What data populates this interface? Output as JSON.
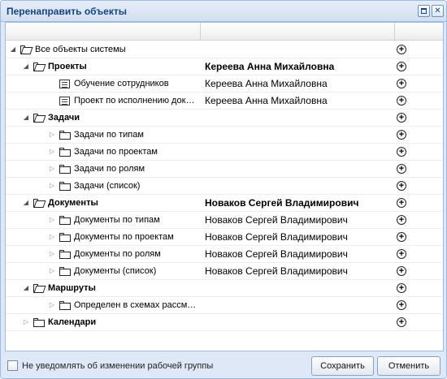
{
  "window": {
    "title": "Перенаправить объекты",
    "maximize_label": "",
    "close_label": "✕"
  },
  "tree": {
    "rows": [
      {
        "label": "Все объекты системы",
        "assignee": "",
        "bold": false,
        "icon": "folder-open-icon",
        "arrow": "expanded"
      },
      {
        "label": "Проекты",
        "assignee": "Кереева Анна Михайловна",
        "bold": true,
        "icon": "folder-open-icon",
        "arrow": "expanded"
      },
      {
        "label": "Обучение сотрудников",
        "assignee": "Кереева Анна Михайловна",
        "bold": false,
        "icon": "document-icon",
        "arrow": "none"
      },
      {
        "label": "Проект по исполнению докуме...",
        "assignee": "Кереева Анна Михайловна",
        "bold": false,
        "icon": "document-icon",
        "arrow": "none"
      },
      {
        "label": "Задачи",
        "assignee": "",
        "bold": true,
        "icon": "folder-open-icon",
        "arrow": "expanded"
      },
      {
        "label": "Задачи по типам",
        "assignee": "",
        "bold": false,
        "icon": "folder-icon",
        "arrow": "collapsed"
      },
      {
        "label": "Задачи по проектам",
        "assignee": "",
        "bold": false,
        "icon": "folder-icon",
        "arrow": "collapsed"
      },
      {
        "label": "Задачи по ролям",
        "assignee": "",
        "bold": false,
        "icon": "folder-icon",
        "arrow": "collapsed"
      },
      {
        "label": "Задачи (список)",
        "assignee": "",
        "bold": false,
        "icon": "folder-icon",
        "arrow": "collapsed"
      },
      {
        "label": "Документы",
        "assignee": "Новаков Сергей Владимирович",
        "bold": true,
        "icon": "folder-open-icon",
        "arrow": "expanded"
      },
      {
        "label": "Документы по типам",
        "assignee": "Новаков Сергей Владимирович",
        "bold": false,
        "icon": "folder-icon",
        "arrow": "collapsed"
      },
      {
        "label": "Документы по проектам",
        "assignee": "Новаков Сергей Владимирович",
        "bold": false,
        "icon": "folder-icon",
        "arrow": "collapsed"
      },
      {
        "label": "Документы по ролям",
        "assignee": "Новаков Сергей Владимирович",
        "bold": false,
        "icon": "folder-icon",
        "arrow": "collapsed"
      },
      {
        "label": "Документы (список)",
        "assignee": "Новаков Сергей Владимирович",
        "bold": false,
        "icon": "folder-icon",
        "arrow": "collapsed"
      },
      {
        "label": "Маршруты",
        "assignee": "",
        "bold": true,
        "icon": "folder-open-icon",
        "arrow": "expanded"
      },
      {
        "label": "Определен в схемах рассмотр...",
        "assignee": "",
        "bold": false,
        "icon": "folder-icon",
        "arrow": "collapsed"
      },
      {
        "label": "Календари",
        "assignee": "",
        "bold": true,
        "icon": "folder-icon",
        "arrow": "collapsed"
      }
    ]
  },
  "footer": {
    "notify_label": "Не уведомлять об изменении рабочей группы",
    "save_label": "Сохранить",
    "cancel_label": "Отменить"
  }
}
